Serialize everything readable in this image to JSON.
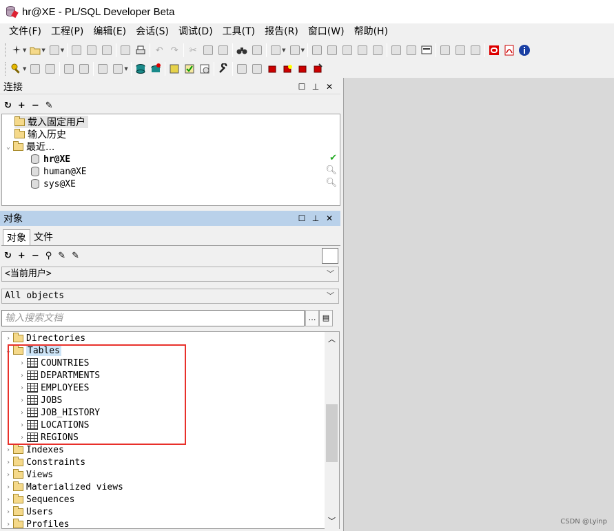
{
  "window": {
    "title": "hr@XE - PL/SQL Developer Beta"
  },
  "menu": [
    "文件(F)",
    "工程(P)",
    "编辑(E)",
    "会话(S)",
    "调试(D)",
    "工具(T)",
    "报告(R)",
    "窗口(W)",
    "帮助(H)"
  ],
  "connections_pane": {
    "title": "连接",
    "items": [
      {
        "label": "载入固定用户"
      },
      {
        "label": "输入历史"
      },
      {
        "label": "最近..."
      },
      {
        "label": "hr@XE"
      },
      {
        "label": "human@XE"
      },
      {
        "label": "sys@XE"
      }
    ]
  },
  "objects_pane": {
    "title": "对象",
    "tabs": [
      "对象",
      "文件"
    ],
    "user_filter": "<当前用户>",
    "object_filter": "All objects",
    "search_placeholder": "输入搜索文档",
    "tree": [
      {
        "label": "Directories"
      },
      {
        "label": "Tables"
      },
      {
        "label": "COUNTRIES"
      },
      {
        "label": "DEPARTMENTS"
      },
      {
        "label": "EMPLOYEES"
      },
      {
        "label": "JOBS"
      },
      {
        "label": "JOB_HISTORY"
      },
      {
        "label": "LOCATIONS"
      },
      {
        "label": "REGIONS"
      },
      {
        "label": "Indexes"
      },
      {
        "label": "Constraints"
      },
      {
        "label": "Views"
      },
      {
        "label": "Materialized views"
      },
      {
        "label": "Sequences"
      },
      {
        "label": "Users"
      },
      {
        "label": "Profiles"
      }
    ]
  },
  "watermark": "CSDN @Lyinp",
  "colors": {
    "highlight_box": "#e8302a",
    "pane_header_active": "#b9d1ea"
  }
}
